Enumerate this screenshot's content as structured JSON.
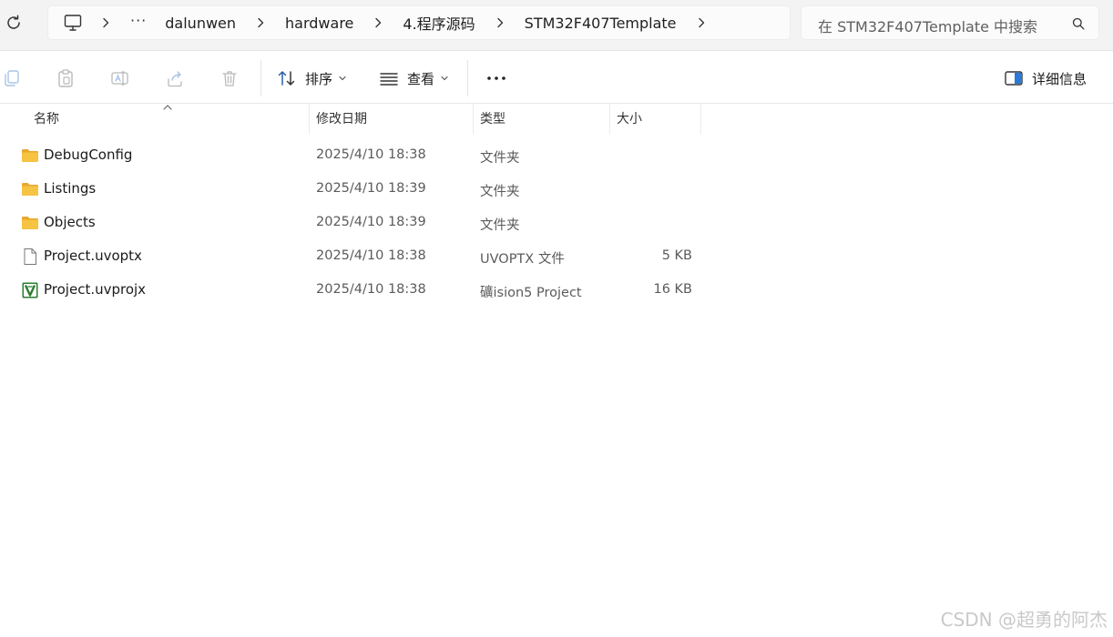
{
  "address_bar": {
    "ellipsis": "···",
    "crumbs": [
      "dalunwen",
      "hardware",
      "4.程序源码",
      "STM32F407Template"
    ]
  },
  "search": {
    "placeholder": "在 STM32F407Template 中搜索"
  },
  "toolbar": {
    "sort_label": "排序",
    "view_label": "查看",
    "more_label": "•••",
    "details_label": "详细信息"
  },
  "columns": {
    "name": "名称",
    "modified": "修改日期",
    "type": "类型",
    "size": "大小"
  },
  "files": [
    {
      "name": "DebugConfig",
      "modified": "2025/4/10 18:38",
      "type": "文件夹",
      "size": "",
      "icon": "folder-icon"
    },
    {
      "name": "Listings",
      "modified": "2025/4/10 18:39",
      "type": "文件夹",
      "size": "",
      "icon": "folder-icon"
    },
    {
      "name": "Objects",
      "modified": "2025/4/10 18:39",
      "type": "文件夹",
      "size": "",
      "icon": "folder-icon"
    },
    {
      "name": "Project.uvoptx",
      "modified": "2025/4/10 18:38",
      "type": "UVOPTX 文件",
      "size": "5 KB",
      "icon": "blank-file-icon"
    },
    {
      "name": "Project.uvprojx",
      "modified": "2025/4/10 18:38",
      "type": "礦ision5 Project",
      "size": "16 KB",
      "icon": "uvision-project-icon"
    }
  ],
  "watermark": "CSDN @超勇的阿杰",
  "colors": {
    "folder": "#f6c343",
    "folder_tab": "#e8a82e",
    "uvision_green": "#2e7d32",
    "toolbar_bg": "#f3f3f3"
  }
}
